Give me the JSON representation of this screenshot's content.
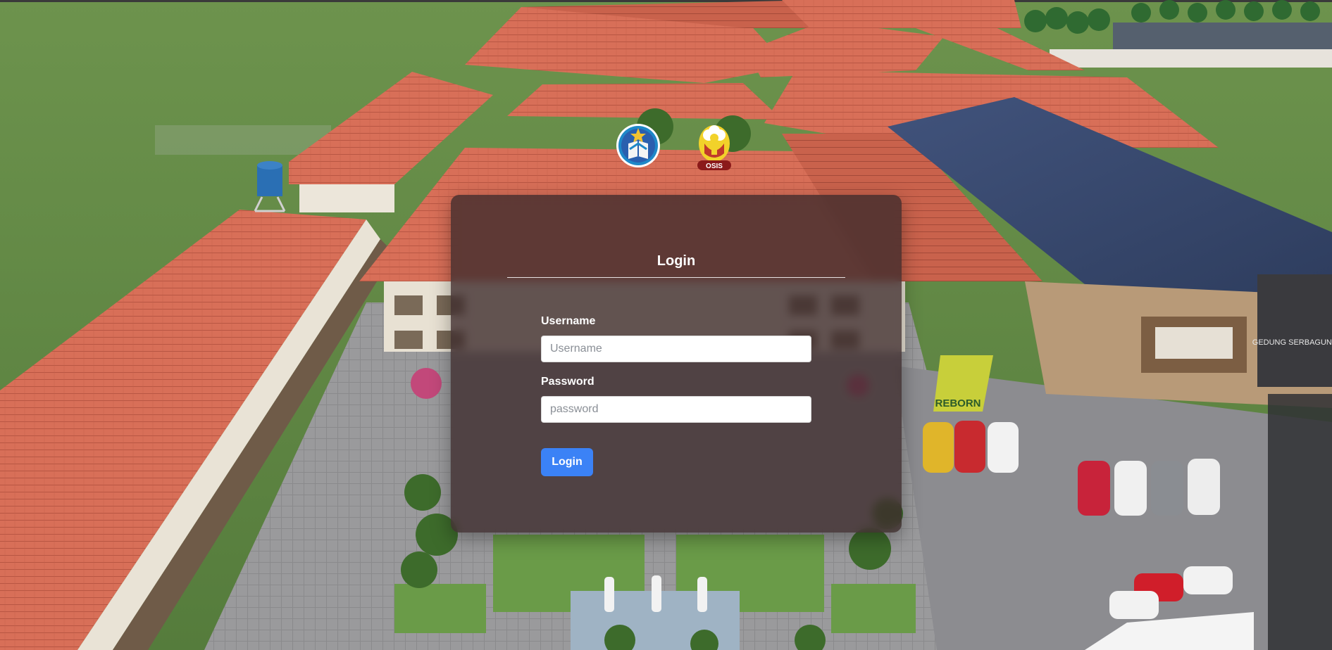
{
  "logos": {
    "left_icon": "school-crest-icon",
    "right_icon": "osis-emblem-icon",
    "right_text": "OSIS"
  },
  "background": {
    "sign_text": "REBORN",
    "building_sign": "GEDUNG SERBAGUNA"
  },
  "login": {
    "title": "Login",
    "username_label": "Username",
    "username_placeholder": "Username",
    "username_value": "",
    "password_label": "Password",
    "password_placeholder": "password",
    "password_value": "",
    "submit_label": "Login"
  },
  "colors": {
    "button": "#3b82f6",
    "card": "rgba(60,42,44,0.78)",
    "roof": "#d9705a",
    "grass": "#5f8a46"
  }
}
